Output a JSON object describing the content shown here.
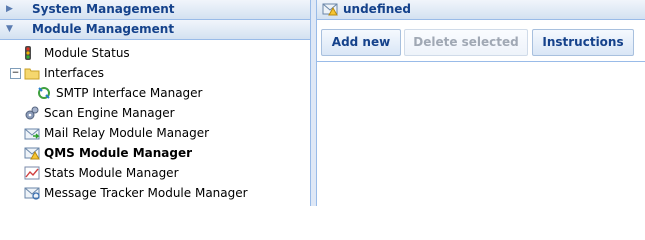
{
  "sidebar": {
    "sections": {
      "system_management": "System Management",
      "module_management": "Module Management"
    },
    "tree": [
      {
        "label": "Module Status",
        "icon": "traffic-light-icon"
      },
      {
        "label": "Interfaces",
        "icon": "folder-icon",
        "toggle": "−"
      },
      {
        "label": "SMTP Interface Manager",
        "icon": "smtp-interface-icon"
      },
      {
        "label": "Scan Engine Manager",
        "icon": "gears-icon"
      },
      {
        "label": "Mail Relay Module Manager",
        "icon": "mail-relay-icon"
      },
      {
        "label": "QMS Module Manager",
        "icon": "mail-warning-icon"
      },
      {
        "label": "Stats Module Manager",
        "icon": "stats-chart-icon"
      },
      {
        "label": "Message Tracker Module Manager",
        "icon": "message-tracker-icon"
      }
    ]
  },
  "main": {
    "title": "undefined",
    "title_icon": "mail-warning-icon",
    "toolbar": {
      "add_new": "Add new",
      "delete_selected": "Delete selected",
      "instructions": "Instructions"
    }
  },
  "colors": {
    "header_text": "#15428b",
    "border": "#99bbe8"
  }
}
